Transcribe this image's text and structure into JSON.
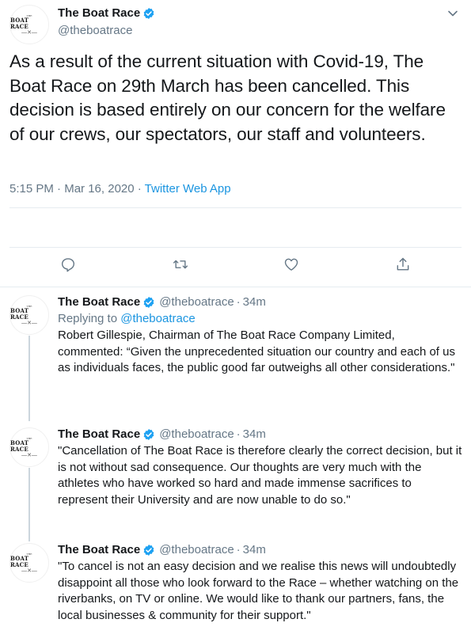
{
  "main_tweet": {
    "account_name": "The Boat Race",
    "handle": "@theboatrace",
    "avatar_text_top": "THE",
    "avatar_text": "BOAT RACE",
    "text": "As a result of the current situation with Covid-19, The Boat Race on 29th March has been cancelled. This decision is based entirely on our concern for the welfare of our crews, our spectators, our staff and volunteers.",
    "time": "5:15 PM",
    "date": "Mar 16, 2020",
    "source": "Twitter Web App",
    "separator": " · "
  },
  "actions": {
    "reply_icon": "reply-icon",
    "retweet_icon": "retweet-icon",
    "like_icon": "heart-icon",
    "share_icon": "share-icon"
  },
  "replies": [
    {
      "account_name": "The Boat Race",
      "handle": "@theboatrace",
      "time_ago": "34m",
      "replying_label": "Replying to ",
      "replying_to": "@theboatrace",
      "text": "Robert Gillespie, Chairman of The Boat Race Company Limited, commented: “Given the unprecedented situation our country and each of us as individuals faces, the public good far outweighs all other considerations.\""
    },
    {
      "account_name": "The Boat Race",
      "handle": "@theboatrace",
      "time_ago": "34m",
      "text": "\"Cancellation of The Boat Race is therefore clearly the correct decision, but it is not without sad consequence. Our thoughts are very much with the athletes who have worked so hard and made immense sacrifices to represent their University and are now unable to do so.\""
    },
    {
      "account_name": "The Boat Race",
      "handle": "@theboatrace",
      "time_ago": "34m",
      "text": "\"To cancel is not an easy decision and we realise this news will undoubtedly disappoint all those who look forward to the Race – whether watching on the riverbanks, on TV or online. We would like to thank our partners, fans, the local businesses & community for their support.\""
    }
  ],
  "colors": {
    "verified": "#1da1f2",
    "link": "#1b95e0",
    "secondary_text": "#657786",
    "icon": "#657786"
  }
}
